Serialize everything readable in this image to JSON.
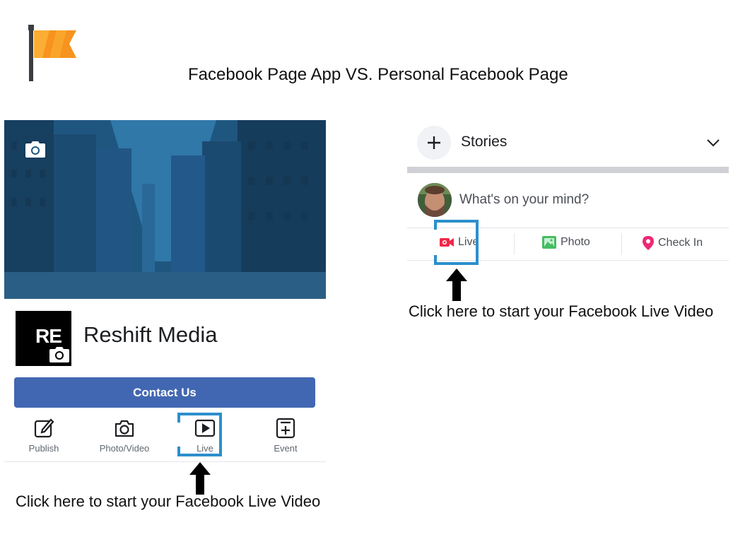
{
  "header": {
    "title": "Facebook Page App VS. Personal Facebook Page",
    "logo_icon": "pages-flag-icon"
  },
  "pages_app": {
    "page_name": "Reshift Media",
    "profile_initials": "RE",
    "contact_button": "Contact Us",
    "actions": [
      {
        "label": "Publish",
        "icon": "edit-icon"
      },
      {
        "label": "Photo/Video",
        "icon": "camera-icon"
      },
      {
        "label": "Live",
        "icon": "play-icon"
      },
      {
        "label": "Event",
        "icon": "add-event-icon"
      }
    ],
    "caption": "Click here to start your Facebook Live Video"
  },
  "personal": {
    "stories_label": "Stories",
    "composer_placeholder": "What's on your mind?",
    "actions": [
      {
        "label": "Live",
        "icon": "live-video-icon",
        "color": "#f02849"
      },
      {
        "label": "Photo",
        "icon": "photo-icon",
        "color": "#45bd62"
      },
      {
        "label": "Check In",
        "icon": "location-pin-icon",
        "color": "#f5533d"
      }
    ],
    "caption": "Click here to start your Facebook Live Video"
  },
  "colors": {
    "brand_blue": "#4267b2",
    "highlight": "#2b8fcd",
    "cover_tint": "#1f5680",
    "flag_orange": "#f7931e"
  }
}
